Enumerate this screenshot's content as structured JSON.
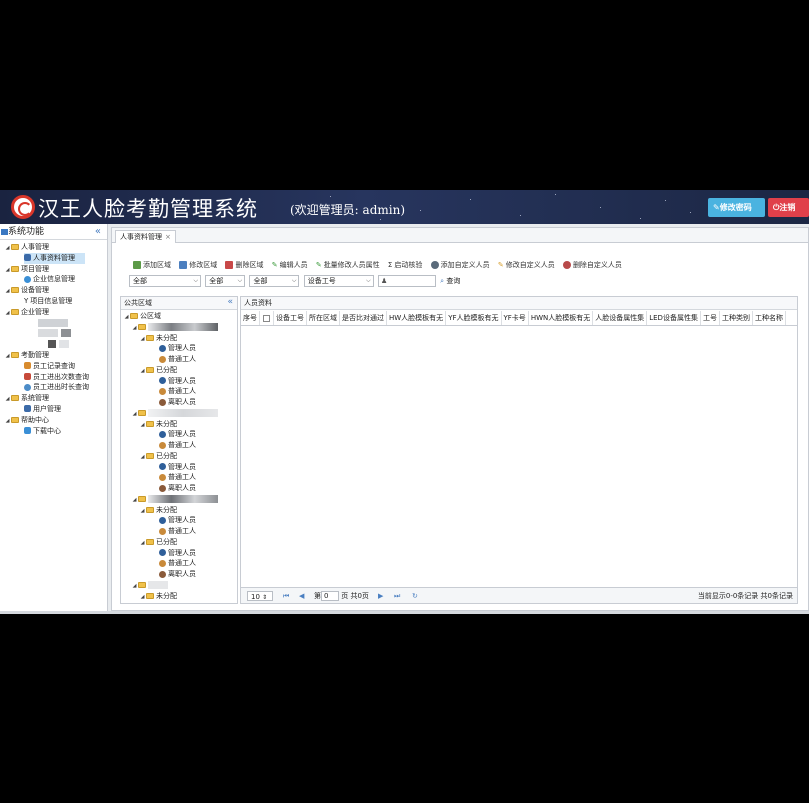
{
  "header": {
    "title": "汉王人脸考勤管理系统",
    "welcome": "(欢迎管理员: admin)",
    "change_password": "修改密码",
    "logout": "注销",
    "colors": {
      "change_password": "#4ab3e0",
      "logout": "#e0404a"
    }
  },
  "sidebar": {
    "title": "系统功能",
    "collapse": "«",
    "items": [
      {
        "label": "人事管理"
      },
      {
        "label": "人事资料管理"
      },
      {
        "label": "项目管理"
      },
      {
        "label": "企业信息管理"
      },
      {
        "label": "设备管理"
      },
      {
        "label": "项目信息管理"
      },
      {
        "label": "企业管理"
      },
      {
        "label": "考勤管理"
      },
      {
        "label": "员工记录查询"
      },
      {
        "label": "员工进出次数查询"
      },
      {
        "label": "员工进出时长查询"
      },
      {
        "label": "系统管理"
      },
      {
        "label": "用户管理"
      },
      {
        "label": "帮助中心"
      },
      {
        "label": "下载中心"
      }
    ]
  },
  "tab": {
    "label": "人事资料管理",
    "close": "×"
  },
  "toolbar": {
    "add_region": "添加区域",
    "edit_region": "修改区域",
    "delete_region": "删除区域",
    "edit_person": "编辑人员",
    "batch_edit": "批量修改人员属性",
    "enable_verify": "启动核验",
    "add_custom": "添加自定义人员",
    "edit_custom": "修改自定义人员",
    "delete_custom": "删除自定义人员"
  },
  "filters": {
    "f1": "全部",
    "f2": "全部",
    "f3": "全部",
    "f4": "设备工号",
    "query": "查询"
  },
  "region_panel": {
    "title": "公共区域",
    "collapse": "«",
    "root": "公区域",
    "unassigned": "未分配",
    "assigned": "已分配",
    "manager": "管理人员",
    "worker": "普通工人",
    "resigned": "离职人员"
  },
  "personnel": {
    "title": "人员资料",
    "columns": [
      "序号",
      "设备工号",
      "所在区域",
      "是否比对通过",
      "HW人脸模板有无",
      "YF人脸模板有无",
      "YF卡号",
      "HWN人脸模板有无",
      "人脸设备属性集",
      "LED设备属性集",
      "工号",
      "工种类别",
      "工种名称"
    ]
  },
  "pager": {
    "page_size": "10",
    "page_prefix": "第",
    "page_value": "0",
    "page_suffix": "页 共0页",
    "summary": "当前显示0-0条记录 共0条记录"
  }
}
